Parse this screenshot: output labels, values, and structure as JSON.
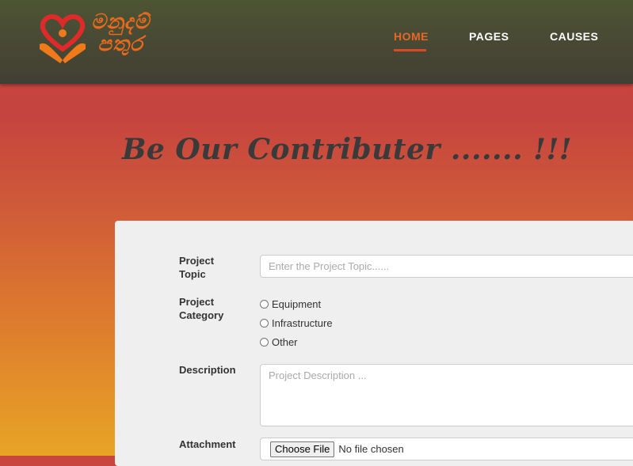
{
  "header": {
    "logo_text": "මනුදම් පතුර",
    "nav": [
      {
        "label": "HOME",
        "active": true
      },
      {
        "label": "PAGES",
        "active": false
      },
      {
        "label": "CAUSES",
        "active": false
      }
    ]
  },
  "page_heading": "Be Our Contributer ....... !!!",
  "form": {
    "topic_label": "Project Topic",
    "topic_placeholder": "Enter the Project Topic......",
    "category_label": "Project Category",
    "category_options": [
      "Equipment",
      "Infrastructure",
      "Other"
    ],
    "description_label": "Description",
    "description_placeholder": "Project Description ...",
    "attachment_label": "Attachment",
    "file_button_label": "Choose File",
    "file_status": "No file chosen"
  },
  "colors": {
    "navbar": "#474734",
    "accent": "#e8662a",
    "heading": "#3a3a3a",
    "panel": "#efefef"
  }
}
